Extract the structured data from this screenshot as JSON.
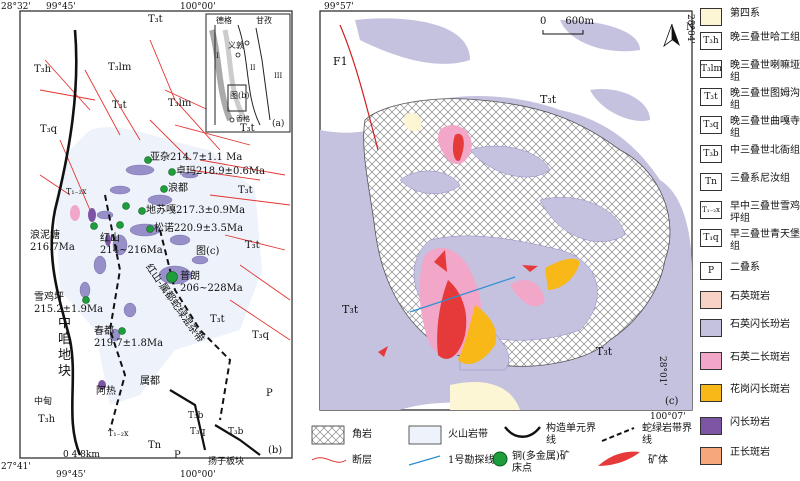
{
  "map_a": {
    "top_left_coord": "28°32'",
    "top_lon_left": "99°45'",
    "top_lon_right": "100°00'",
    "bottom_left_coord": "27°41'",
    "bottom_lon_left": "99°45'",
    "bottom_lon_right": "100°00'",
    "scale_label": "0  4  8km",
    "panel_label": "(b)",
    "units": {
      "t3t": "T₃t",
      "t3h": "T₃h",
      "t3lm": "T₃lm",
      "t3q": "T₃q",
      "t12x": "T₁₋₂x",
      "p": "P",
      "t3b": "T₃b",
      "tn": "Tn"
    },
    "deposits": [
      {
        "name": "亚杂214.7±1.1 Ma"
      },
      {
        "name": "卓玛218.9±0.6Ma"
      },
      {
        "name": "浪都"
      },
      {
        "name": "地苏嘎217.3±0.9Ma"
      },
      {
        "name": "松诺220.9±3.5Ma"
      },
      {
        "name": "浪泥塘216.7Ma"
      },
      {
        "name": "红山214~216Ma"
      },
      {
        "name": "普朗206~228Ma"
      },
      {
        "name": "雪鸡坪215.2±1.9Ma"
      },
      {
        "name": "春都219.7±1.8Ma"
      },
      {
        "name": "阿热"
      },
      {
        "name": "属都"
      }
    ],
    "labels": {
      "zhongza": "中咱地块",
      "belt": "红山-属都蛇绿混杂带",
      "zhongdian": "中甸",
      "yangzi": "扬子板块",
      "fig_c": "图(c)"
    },
    "inset": {
      "label": "(a)",
      "towns": [
        "德格",
        "甘孜",
        "义敦",
        "图(b)",
        "香格"
      ],
      "roman": [
        "I",
        "II",
        "III"
      ]
    }
  },
  "map_c": {
    "top_lon": "99°57'",
    "right_lat_top": "28°04'",
    "right_lat_bottom": "28°01'",
    "bottom_lon": "100°07'",
    "panel_label": "(c)",
    "scale": "0      600m",
    "north": "N",
    "fault_label": "F1",
    "unit_t3t": "T₃t"
  },
  "legend_right": [
    {
      "sym": "",
      "color": "#fdf6d5",
      "label": "第四系"
    },
    {
      "sym": "T₃h",
      "color": "#ffffff",
      "label": "晚三叠世哈工组"
    },
    {
      "sym": "T₃lm",
      "color": "#ffffff",
      "label": "晚三叠世喇嘛垭组"
    },
    {
      "sym": "T₃t",
      "color": "#ffffff",
      "label": "晚三叠世图姆沟组"
    },
    {
      "sym": "T₃q",
      "color": "#ffffff",
      "label": "晚三叠世曲嘎寺组"
    },
    {
      "sym": "T₃b",
      "color": "#ffffff",
      "label": "中三叠世北衙组"
    },
    {
      "sym": "Tn",
      "color": "#ffffff",
      "label": "三叠系尼汝组"
    },
    {
      "sym": "T₁₋₂x",
      "color": "#ffffff",
      "label": "早中三叠世雪鸡坪组"
    },
    {
      "sym": "T₁q",
      "color": "#ffffff",
      "label": "早三叠世青天堡组"
    },
    {
      "sym": "P",
      "color": "#ffffff",
      "label": "二叠系"
    },
    {
      "sym": "",
      "color": "#f9d2c7",
      "label": "石英斑岩"
    },
    {
      "sym": "",
      "color": "#c5c2e0",
      "label": "石英闪长玢岩"
    },
    {
      "sym": "",
      "color": "#f2a7c9",
      "label": "石英二长斑岩"
    },
    {
      "sym": "",
      "color": "#f7b818",
      "label": "花岗闪长斑岩"
    },
    {
      "sym": "",
      "color": "#7d55a5",
      "label": "闪长玢岩"
    },
    {
      "sym": "",
      "color": "#f6a87c",
      "label": "正长斑岩"
    }
  ],
  "legend_bottom": [
    {
      "label": "角岩"
    },
    {
      "label": "火山岩带"
    },
    {
      "label": "构造单元界线"
    },
    {
      "label": "蛇绿岩带界线"
    },
    {
      "label": "断层"
    },
    {
      "label": "1号勘探线"
    },
    {
      "label": "铜(多金属)矿床点"
    },
    {
      "label": "矿体"
    }
  ]
}
